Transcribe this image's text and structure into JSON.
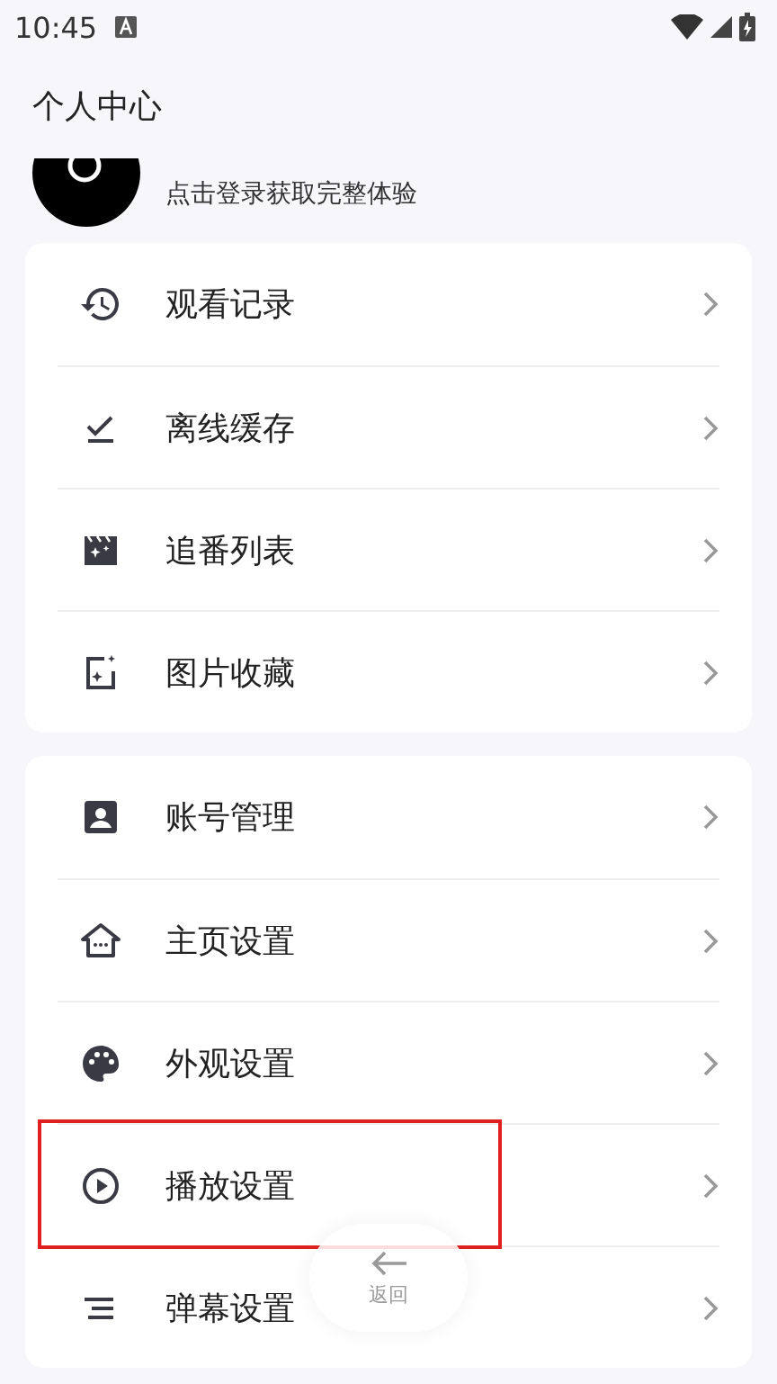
{
  "status_bar": {
    "time": "10:45"
  },
  "header": {
    "title": "个人中心"
  },
  "profile": {
    "prompt": "点击登录获取完整体验"
  },
  "menu_groups": [
    {
      "items": [
        {
          "kind": "history",
          "label": "观看记录",
          "highlighted": false
        },
        {
          "kind": "download",
          "label": "离线缓存",
          "highlighted": false
        },
        {
          "kind": "clapper",
          "label": "追番列表",
          "highlighted": false
        },
        {
          "kind": "image",
          "label": "图片收藏",
          "highlighted": false
        }
      ]
    },
    {
      "items": [
        {
          "kind": "account",
          "label": "账号管理",
          "highlighted": false
        },
        {
          "kind": "home",
          "label": "主页设置",
          "highlighted": false
        },
        {
          "kind": "palette",
          "label": "外观设置",
          "highlighted": false
        },
        {
          "kind": "play",
          "label": "播放设置",
          "highlighted": true
        },
        {
          "kind": "lines",
          "label": "弹幕设置",
          "highlighted": false
        }
      ]
    }
  ],
  "back_button": {
    "label": "返回"
  }
}
